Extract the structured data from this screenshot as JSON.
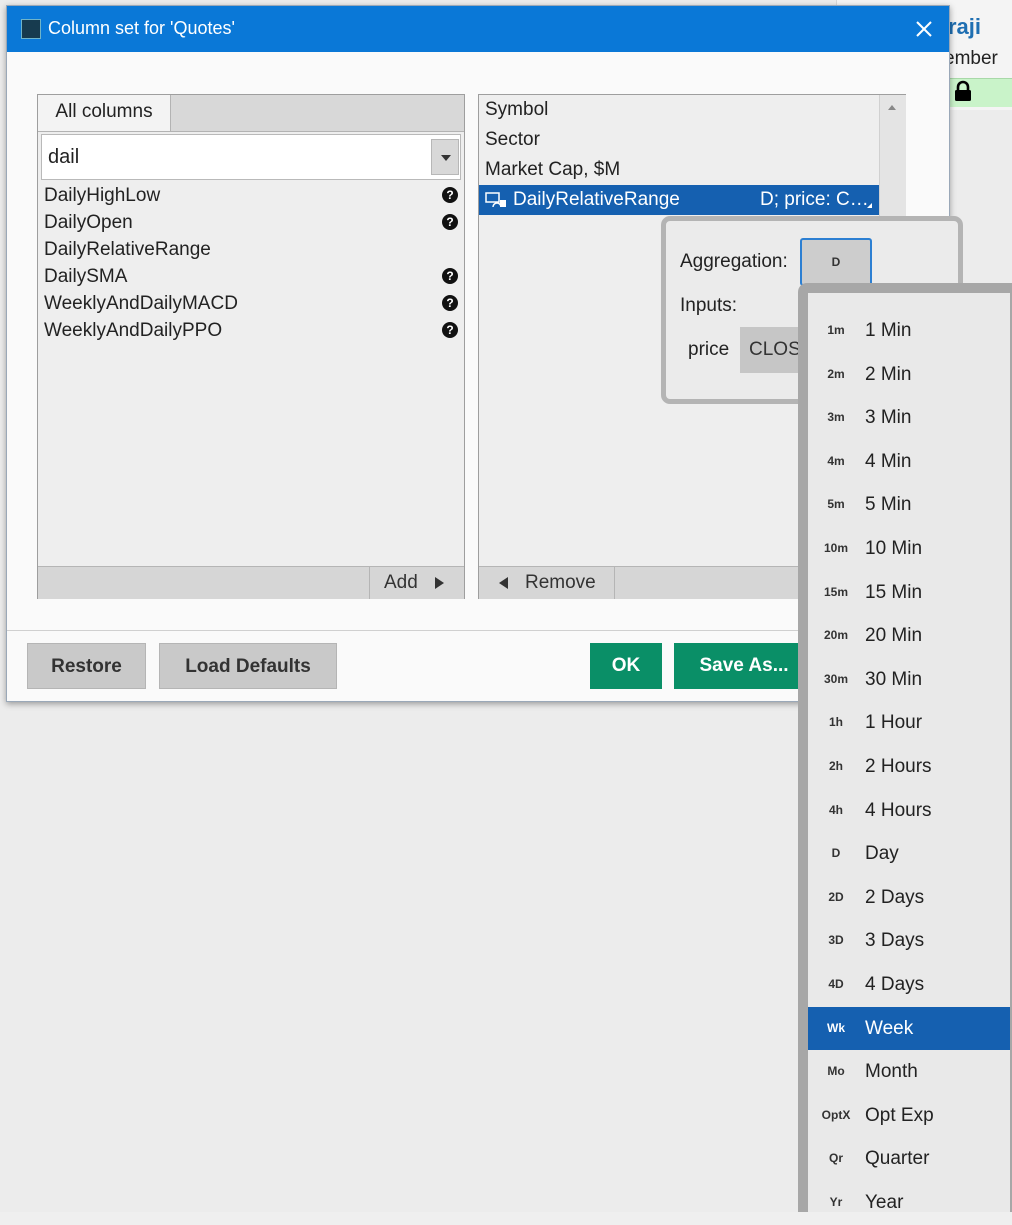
{
  "background": {
    "name_partial": "raji",
    "subtitle_partial": "ember",
    "lock_icon": "lock-icon"
  },
  "dialog": {
    "title": "Column set for 'Quotes'",
    "close_icon": "close-icon"
  },
  "left_panel": {
    "tab_label": "All columns",
    "search_value": "dail",
    "items": [
      {
        "label": "DailyHighLow",
        "has_help": true
      },
      {
        "label": "DailyOpen",
        "has_help": true
      },
      {
        "label": "DailyRelativeRange",
        "has_help": false
      },
      {
        "label": "DailySMA",
        "has_help": true
      },
      {
        "label": "WeeklyAndDailyMACD",
        "has_help": true
      },
      {
        "label": "WeeklyAndDailyPPO",
        "has_help": true
      }
    ],
    "help_glyph": "?",
    "add_label": "Add"
  },
  "right_panel": {
    "items": [
      "Symbol",
      "Sector",
      "Market Cap, $M"
    ],
    "selected_item": {
      "label": "DailyRelativeRange",
      "params": "D; price: C…"
    },
    "remove_label": "Remove"
  },
  "buttons": {
    "restore": "Restore",
    "load_defaults": "Load Defaults",
    "ok": "OK",
    "save_as": "Save As..."
  },
  "aggregation_popup": {
    "aggregation_label": "Aggregation:",
    "aggregation_value": "D",
    "inputs_label": "Inputs:",
    "price_label": "price",
    "price_value": "CLOSE"
  },
  "timeframes": [
    {
      "abbr": "1m",
      "label": "1 Min"
    },
    {
      "abbr": "2m",
      "label": "2 Min"
    },
    {
      "abbr": "3m",
      "label": "3 Min"
    },
    {
      "abbr": "4m",
      "label": "4 Min"
    },
    {
      "abbr": "5m",
      "label": "5 Min"
    },
    {
      "abbr": "10m",
      "label": "10 Min"
    },
    {
      "abbr": "15m",
      "label": "15 Min"
    },
    {
      "abbr": "20m",
      "label": "20 Min"
    },
    {
      "abbr": "30m",
      "label": "30 Min"
    },
    {
      "abbr": "1h",
      "label": "1 Hour"
    },
    {
      "abbr": "2h",
      "label": "2 Hours"
    },
    {
      "abbr": "4h",
      "label": "4 Hours"
    },
    {
      "abbr": "D",
      "label": "Day"
    },
    {
      "abbr": "2D",
      "label": "2 Days"
    },
    {
      "abbr": "3D",
      "label": "3 Days"
    },
    {
      "abbr": "4D",
      "label": "4 Days"
    },
    {
      "abbr": "Wk",
      "label": "Week",
      "selected": true
    },
    {
      "abbr": "Mo",
      "label": "Month"
    },
    {
      "abbr": "OptX",
      "label": "Opt Exp"
    },
    {
      "abbr": "Qr",
      "label": "Quarter"
    },
    {
      "abbr": "Yr",
      "label": "Year"
    }
  ],
  "colors": {
    "title_bar": "#0a78d7",
    "selection": "#1560b0",
    "primary_button": "#0a8f67",
    "lock_cell": "#c9f3c9"
  }
}
